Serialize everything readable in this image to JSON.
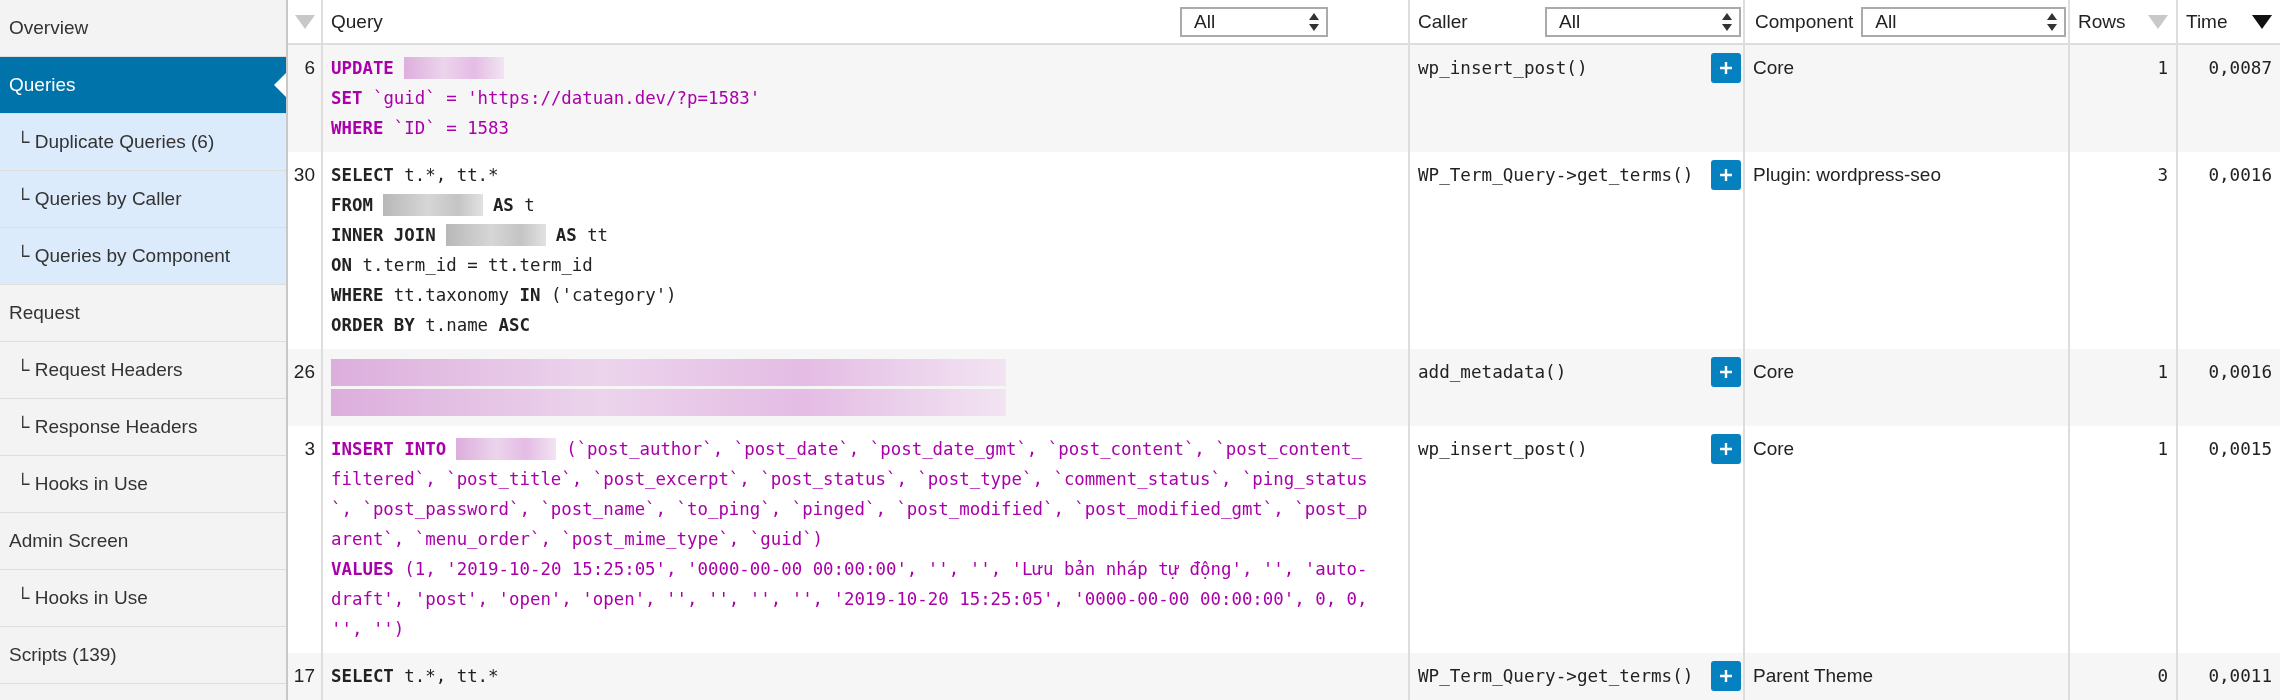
{
  "sidebar": {
    "items": [
      {
        "label": "Overview",
        "selected": false
      },
      {
        "label": "Queries",
        "selected": true,
        "children": [
          {
            "label": "└ Duplicate Queries (6)",
            "selected": false
          },
          {
            "label": "└ Queries by Caller",
            "selected": false
          },
          {
            "label": "└ Queries by Component",
            "selected": false
          }
        ]
      },
      {
        "label": "Request",
        "selected": false,
        "children": [
          {
            "label": "└ Request Headers",
            "selected": false
          },
          {
            "label": "└ Response Headers",
            "selected": false
          },
          {
            "label": "└ Hooks in Use",
            "selected": false
          }
        ]
      },
      {
        "label": "Admin Screen",
        "selected": false,
        "children": [
          {
            "label": "└ Hooks in Use",
            "selected": false
          }
        ]
      },
      {
        "label": "Scripts (139)",
        "selected": false
      }
    ]
  },
  "table": {
    "columns": [
      {
        "kind": "sort",
        "sorted": false
      },
      {
        "kind": "filter",
        "label": "Query",
        "filter": "All"
      },
      {
        "kind": "filter",
        "label": "Caller",
        "filter": "All"
      },
      {
        "kind": "filter",
        "label": "Component",
        "filter": "All"
      },
      {
        "kind": "sort",
        "label": "Rows",
        "sorted": false
      },
      {
        "kind": "sort",
        "label": "Time",
        "sorted": true
      }
    ],
    "rows": [
      {
        "number": "6",
        "kind": "write",
        "lines": [
          [
            {
              "text": "UPDATE",
              "bold": true
            },
            {
              "kind": "redacted"
            }
          ],
          [
            {
              "text": "SET",
              "bold": true
            },
            {
              "text": "`guid` = 'https://datuan.dev/?p=1583'"
            }
          ],
          [
            {
              "text": "WHERE",
              "bold": true
            },
            {
              "text": "`ID` = 1583"
            }
          ]
        ],
        "caller": "wp_insert_post()",
        "component": "Core",
        "rows": "1",
        "time": "0,0087"
      },
      {
        "number": "30",
        "kind": "select",
        "lines": [
          [
            {
              "text": "SELECT",
              "bold": true
            },
            {
              "text": "t.*, tt.*"
            }
          ],
          [
            {
              "text": "FROM",
              "bold": true
            },
            {
              "kind": "redacted"
            },
            {
              "text": "AS",
              "bold": true
            },
            {
              "text": "t"
            }
          ],
          [
            {
              "text": "INNER JOIN",
              "bold": true
            },
            {
              "kind": "redacted"
            },
            {
              "text": "AS",
              "bold": true
            },
            {
              "text": "tt"
            }
          ],
          [
            {
              "text": "ON",
              "bold": true
            },
            {
              "text": "t.term_id = tt.term_id"
            }
          ],
          [
            {
              "text": "WHERE",
              "bold": true
            },
            {
              "text": "tt.taxonomy"
            },
            {
              "text": "IN",
              "bold": true
            },
            {
              "text": "('category')"
            }
          ],
          [
            {
              "text": "ORDER BY",
              "bold": true
            },
            {
              "text": "t.name"
            },
            {
              "text": "ASC",
              "bold": true
            }
          ]
        ],
        "caller": "WP_Term_Query->get_terms()",
        "component": "Plugin: wordpress-seo",
        "rows": "3",
        "time": "0,0016"
      },
      {
        "number": "26",
        "kind": "write",
        "lines": [
          [
            {
              "kind": "redacted-line"
            }
          ],
          [
            {
              "kind": "redacted-line"
            }
          ]
        ],
        "caller": "add_metadata()",
        "component": "Core",
        "rows": "1",
        "time": "0,0016"
      },
      {
        "number": "3",
        "kind": "write",
        "lines": [
          [
            {
              "text": "INSERT INTO",
              "bold": true
            },
            {
              "kind": "redacted"
            },
            {
              "text": "(`post_author`, `post_date`, `post_date_gmt`, `post_content`, `post_content_"
            }
          ],
          [
            {
              "text": "filtered`, `post_title`, `post_excerpt`, `post_status`, `post_type`, `comment_status`, `ping_status"
            }
          ],
          [
            {
              "text": "`, `post_password`, `post_name`, `to_ping`, `pinged`, `post_modified`, `post_modified_gmt`, `post_p"
            }
          ],
          [
            {
              "text": "arent`, `menu_order`, `post_mime_type`, `guid`)"
            }
          ],
          [
            {
              "text": "VALUES",
              "bold": true
            },
            {
              "text": "(1, '2019-10-20 15:25:05', '0000-00-00 00:00:00', '', '', 'Lưu bản nháp tự động', '', 'auto-"
            }
          ],
          [
            {
              "text": "draft', 'post', 'open', 'open', '', '', '', '', '2019-10-20 15:25:05', '0000-00-00 00:00:00', 0, 0,"
            }
          ],
          [
            {
              "text": "'', '')"
            }
          ]
        ],
        "caller": "wp_insert_post()",
        "component": "Core",
        "rows": "1",
        "time": "0,0015"
      },
      {
        "number": "17",
        "kind": "select",
        "lines": [
          [
            {
              "text": "SELECT",
              "bold": true
            },
            {
              "text": "t.*, tt.*"
            }
          ]
        ],
        "caller": "WP_Term_Query->get_terms()",
        "component": "Parent Theme",
        "rows": "0",
        "time": "0,0011"
      }
    ]
  }
}
